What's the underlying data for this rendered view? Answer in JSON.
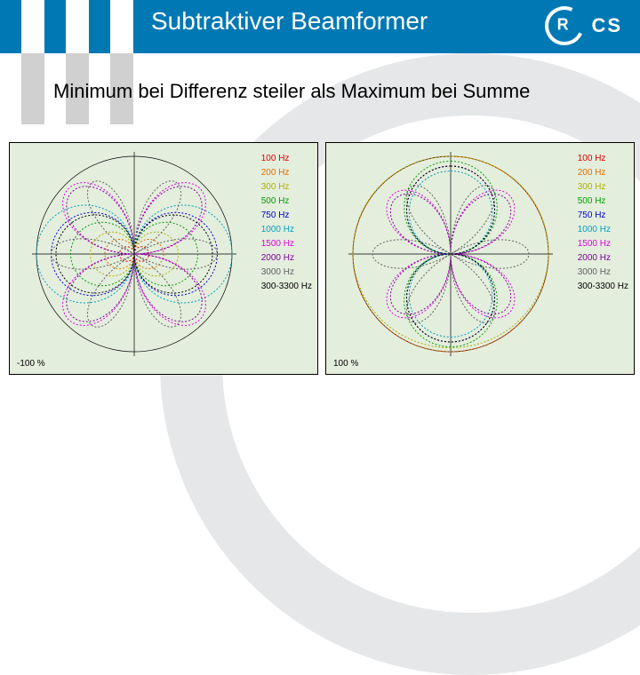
{
  "header": {
    "title": "Subtraktiver Beamformer",
    "logo_r": "R",
    "logo_cs": "CS"
  },
  "subtitle": "Minimum bei Differenz steiler als Maximum bei Summe",
  "legend": [
    {
      "label": "100 Hz",
      "color": "#e00000"
    },
    {
      "label": "200 Hz",
      "color": "#e07000"
    },
    {
      "label": "300 Hz",
      "color": "#b0b000"
    },
    {
      "label": "500 Hz",
      "color": "#00a000"
    },
    {
      "label": "750 Hz",
      "color": "#0000d0"
    },
    {
      "label": "1000 Hz",
      "color": "#00a0c0"
    },
    {
      "label": "1500 Hz",
      "color": "#e000e0"
    },
    {
      "label": "2000 Hz",
      "color": "#8000a0"
    },
    {
      "label": "3000 Hz",
      "color": "#606060"
    },
    {
      "label": "300-3300 Hz",
      "color": "#000000"
    }
  ],
  "plots": [
    {
      "xlabel": "-100 %",
      "pattern": "difference"
    },
    {
      "xlabel": "100 %",
      "pattern": "sum"
    }
  ],
  "chart_data": [
    {
      "type": "polar",
      "title": "Difference beamformer directivity",
      "angle_range_deg": [
        0,
        360
      ],
      "radial_scale": "-100 %",
      "series": [
        {
          "name": "100 Hz",
          "lobes": 2,
          "null_deg": [
            0,
            180
          ],
          "max_deg": [
            90,
            270
          ],
          "relative_gain": 0.15
        },
        {
          "name": "200 Hz",
          "lobes": 2,
          "null_deg": [
            0,
            180
          ],
          "max_deg": [
            90,
            270
          ],
          "relative_gain": 0.3
        },
        {
          "name": "300 Hz",
          "lobes": 2,
          "null_deg": [
            0,
            180
          ],
          "max_deg": [
            90,
            270
          ],
          "relative_gain": 0.45
        },
        {
          "name": "500 Hz",
          "lobes": 2,
          "null_deg": [
            0,
            180
          ],
          "max_deg": [
            90,
            270
          ],
          "relative_gain": 0.65
        },
        {
          "name": "750 Hz",
          "lobes": 2,
          "null_deg": [
            0,
            180
          ],
          "max_deg": [
            90,
            270
          ],
          "relative_gain": 0.85
        },
        {
          "name": "1000 Hz",
          "lobes": 2,
          "null_deg": [
            0,
            180
          ],
          "max_deg": [
            90,
            270
          ],
          "relative_gain": 1.0
        },
        {
          "name": "1500 Hz",
          "lobes": 4,
          "null_deg": [
            0,
            90,
            180,
            270
          ],
          "relative_gain": 0.95
        },
        {
          "name": "2000 Hz",
          "lobes": 4,
          "null_deg": [
            0,
            90,
            180,
            270
          ],
          "relative_gain": 0.9
        },
        {
          "name": "3000 Hz",
          "lobes": 6,
          "null_deg": [
            0,
            60,
            120,
            180,
            240,
            300
          ],
          "relative_gain": 0.85
        },
        {
          "name": "300-3300 Hz",
          "lobes": 2,
          "null_deg": [
            0,
            180
          ],
          "relative_gain": 0.8
        }
      ]
    },
    {
      "type": "polar",
      "title": "Sum beamformer directivity",
      "angle_range_deg": [
        0,
        360
      ],
      "radial_scale": "100 %",
      "series": [
        {
          "name": "100 Hz",
          "lobes": 1,
          "max_deg": [
            0
          ],
          "relative_gain": 1.0
        },
        {
          "name": "200 Hz",
          "lobes": 1,
          "max_deg": [
            0
          ],
          "relative_gain": 1.0
        },
        {
          "name": "300 Hz",
          "lobes": 1,
          "max_deg": [
            0
          ],
          "relative_gain": 0.98
        },
        {
          "name": "500 Hz",
          "lobes": 2,
          "null_deg": [
            90,
            270
          ],
          "relative_gain": 0.95
        },
        {
          "name": "750 Hz",
          "lobes": 2,
          "null_deg": [
            90,
            270
          ],
          "relative_gain": 0.9
        },
        {
          "name": "1000 Hz",
          "lobes": 2,
          "null_deg": [
            90,
            270
          ],
          "relative_gain": 0.85
        },
        {
          "name": "1500 Hz",
          "lobes": 4,
          "null_deg": [
            45,
            135,
            225,
            315
          ],
          "relative_gain": 0.85
        },
        {
          "name": "2000 Hz",
          "lobes": 4,
          "null_deg": [
            45,
            135,
            225,
            315
          ],
          "relative_gain": 0.8
        },
        {
          "name": "3000 Hz",
          "lobes": 6,
          "null_deg": [
            30,
            90,
            150,
            210,
            270,
            330
          ],
          "relative_gain": 0.8
        },
        {
          "name": "300-3300 Hz",
          "lobes": 2,
          "null_deg": [
            90,
            270
          ],
          "relative_gain": 0.9
        }
      ]
    }
  ]
}
